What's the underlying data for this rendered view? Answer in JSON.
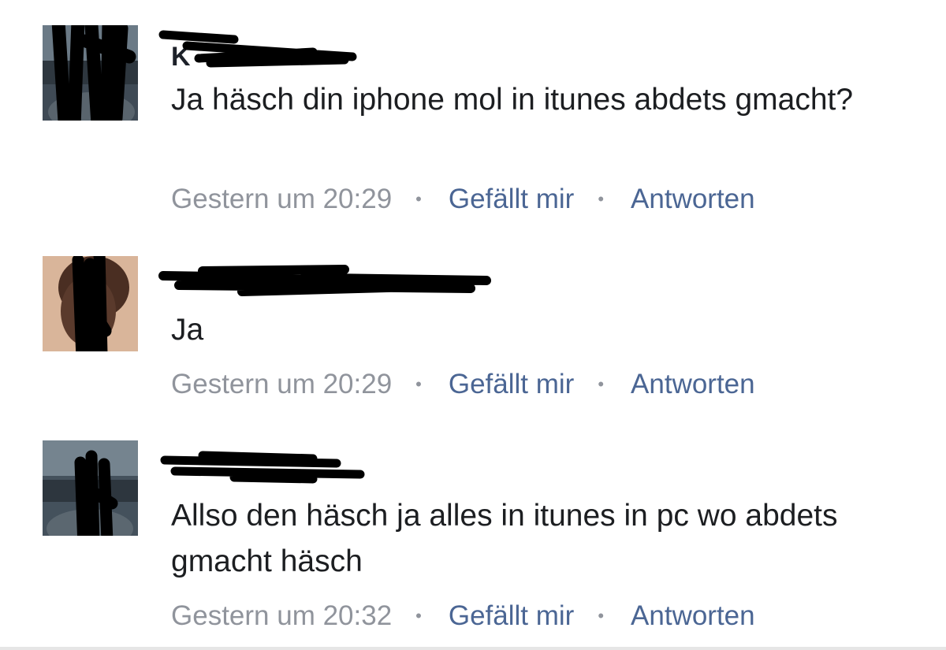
{
  "comments": [
    {
      "author": "K",
      "text": "Ja häsch din iphone mol in itunes abdets gmacht?",
      "time": "Gestern um 20:29",
      "like": "Gefällt mir",
      "reply": "Antworten",
      "avatar_bg": "#3f4a55"
    },
    {
      "author": "",
      "text": "Ja",
      "time": "Gestern um 20:29",
      "like": "Gefällt mir",
      "reply": "Antworten",
      "avatar_bg": "#d9b59a"
    },
    {
      "author": "",
      "text": "Allso den häsch ja alles in itunes in pc wo abdets gmacht häsch",
      "time": "Gestern um 20:32",
      "like": "Gefällt mir",
      "reply": "Antworten",
      "avatar_bg": "#44515c"
    }
  ],
  "separator": "•",
  "colors": {
    "text": "#1c1e21",
    "meta": "#90949c",
    "action": "#4b6694",
    "redaction": "#000000"
  }
}
